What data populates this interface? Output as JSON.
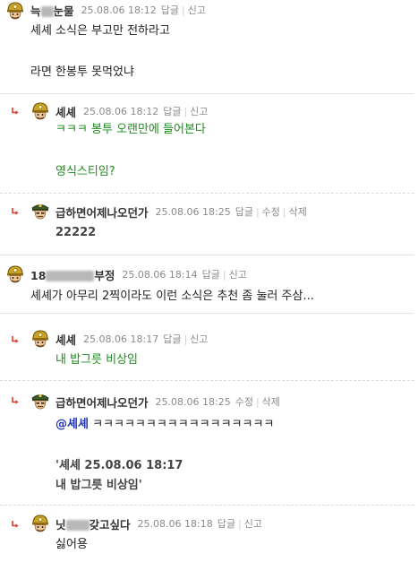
{
  "actions": {
    "reply": "답글",
    "report": "신고",
    "edit": "수정",
    "delete": "삭제"
  },
  "colors": {
    "reply_arrow": "#e03a2c",
    "green_text": "#1b8e1b",
    "mention": "#2437b5",
    "meta": "#8a8a8a"
  },
  "comments": [
    {
      "nickname_prefix": "늑",
      "nickname_suffix": "눈물",
      "time": "25.08.06 18:12",
      "avatar": "miner-avatar-icon",
      "lines": [
        "셰셰 소식은 부고만 전하라고",
        "라면 한봉투 못먹었냐"
      ]
    },
    {
      "nickname": "셰셰",
      "time": "25.08.06 18:12",
      "avatar": "miner-avatar-icon",
      "lines": [
        "ㅋㅋㅋ 봉투 오랜만에 들어본다",
        "영식스티임?"
      ]
    },
    {
      "nickname": "급하면어제나오던가",
      "time": "25.08.06 18:25",
      "avatar": "soldier-avatar-icon",
      "lines": [
        "22222"
      ]
    },
    {
      "nickname_prefix": "18",
      "nickname_suffix": "부정",
      "time": "25.08.06 18:14",
      "avatar": "miner-avatar-icon",
      "lines": [
        "셰셰가 아무리 2찍이라도 이런 소식은 추천 좀 눌러 주삼..."
      ]
    },
    {
      "nickname": "셰셰",
      "time": "25.08.06 18:17",
      "avatar": "miner-avatar-icon",
      "lines": [
        "내 밥그릇 비상임"
      ]
    },
    {
      "nickname": "급하면어제나오던가",
      "time": "25.08.06 18:25",
      "avatar": "soldier-avatar-icon",
      "mention": "@셰셰",
      "mention_text": "ㅋㅋㅋㅋㅋㅋㅋㅋㅋㅋㅋㅋㅋㅋㅋㅋㅋ",
      "quote": [
        "'셰셰 25.08.06 18:17",
        "내 밥그릇 비상임'"
      ]
    },
    {
      "nickname_prefix": "닛",
      "nickname_suffix": "갖고싶다",
      "time": "25.08.06 18:18",
      "avatar": "miner-avatar-icon",
      "lines": [
        "싫어용"
      ]
    }
  ]
}
